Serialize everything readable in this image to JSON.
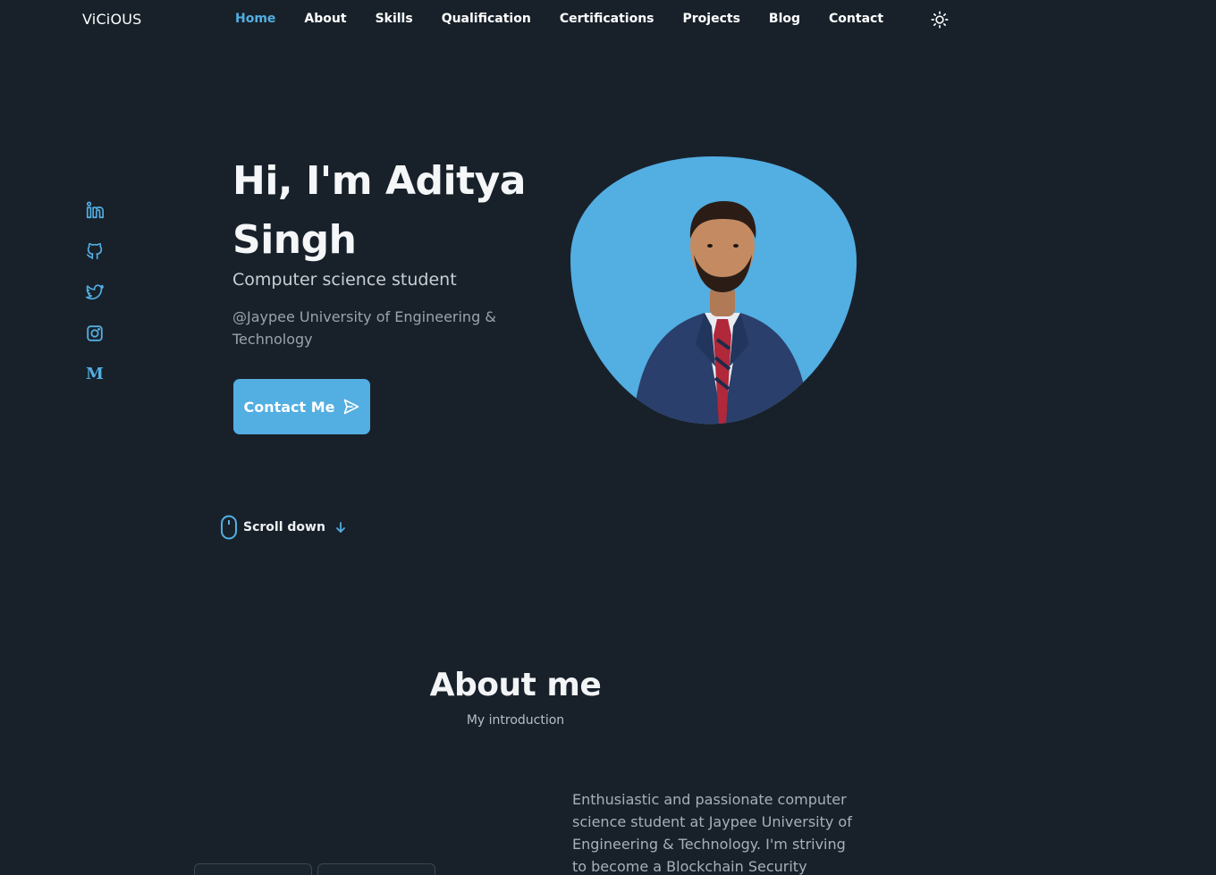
{
  "header": {
    "logo": "ViCiOUS",
    "nav": [
      {
        "label": "Home",
        "active": true
      },
      {
        "label": "About",
        "active": false
      },
      {
        "label": "Skills",
        "active": false
      },
      {
        "label": "Qualification",
        "active": false
      },
      {
        "label": "Certifications",
        "active": false
      },
      {
        "label": "Projects",
        "active": false
      },
      {
        "label": "Blog",
        "active": false
      },
      {
        "label": "Contact",
        "active": false
      }
    ],
    "theme_icon": "sun-icon"
  },
  "social": [
    {
      "name": "linkedin-icon"
    },
    {
      "name": "github-icon"
    },
    {
      "name": "twitter-icon"
    },
    {
      "name": "instagram-icon"
    },
    {
      "name": "medium-icon",
      "glyph": "M"
    }
  ],
  "hero": {
    "title": "Hi, I'm Aditya Singh",
    "subtitle": "Computer science student",
    "description": "@Jaypee University of Engineering & Technology",
    "cta_label": "Contact Me",
    "scroll_label": "Scroll down"
  },
  "about": {
    "title": "About me",
    "subtitle": "My introduction",
    "text": "Enthusiastic and passionate computer science student at Jaypee University of Engineering & Technology. I'm striving to become a Blockchain Security"
  },
  "colors": {
    "background": "#18212a",
    "accent": "#53aee2",
    "text": "#ffffff"
  }
}
